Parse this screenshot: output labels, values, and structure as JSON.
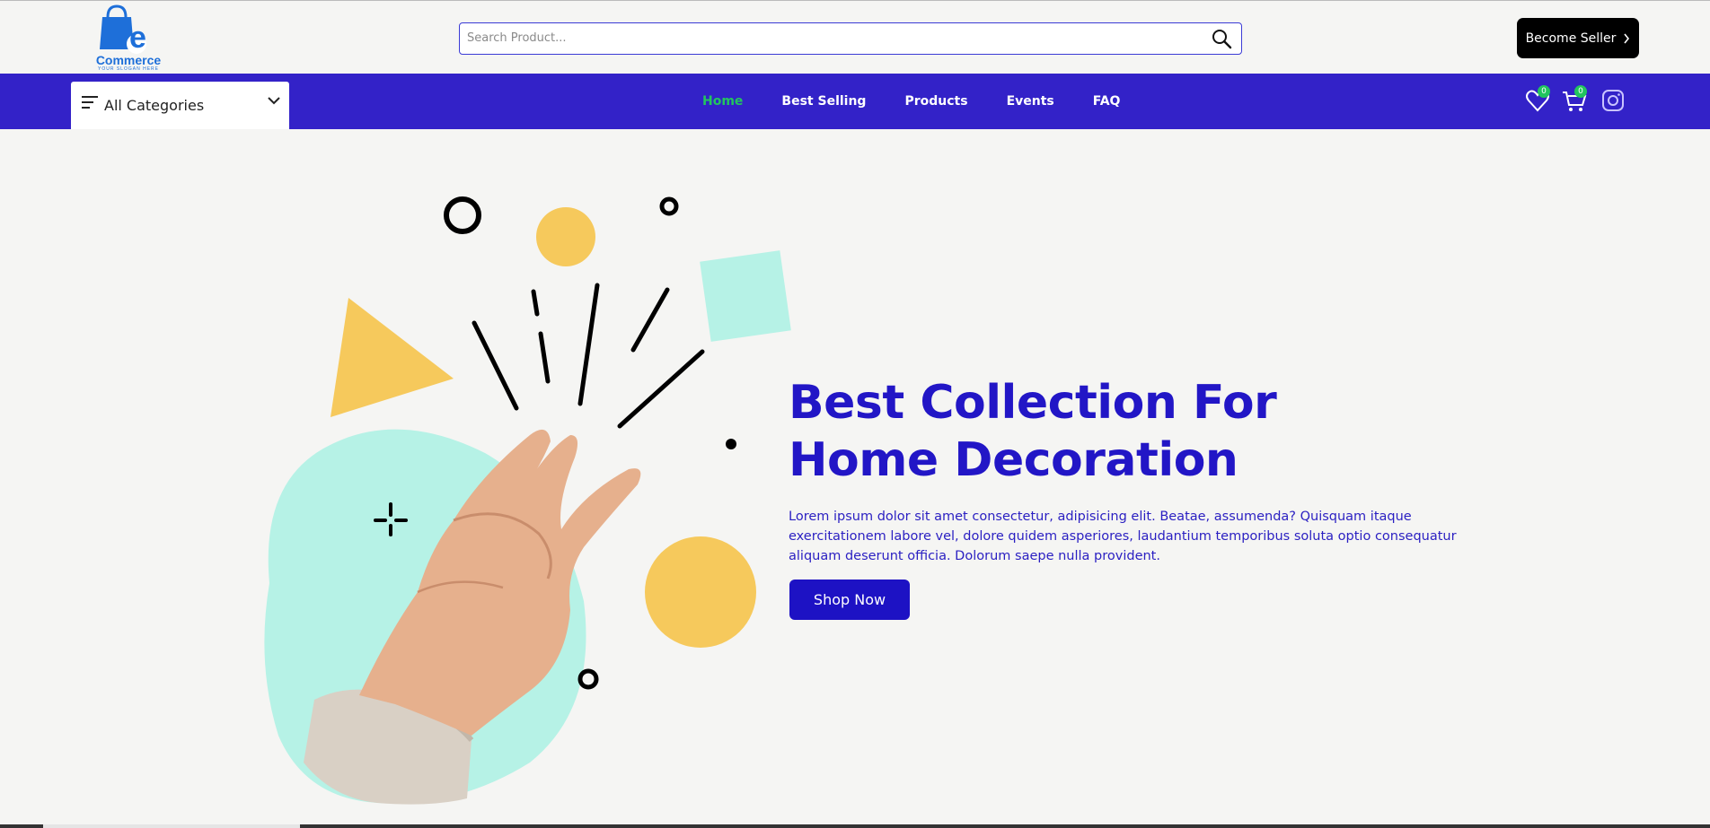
{
  "header": {
    "logo": {
      "word": "Commerce",
      "letter": "e",
      "slogan": "YOUR SLOGAN HERE"
    },
    "search": {
      "placeholder": "Search Product...",
      "value": ""
    },
    "become_seller_label": "Become Seller"
  },
  "nav": {
    "categories_label": "All Categories",
    "links": [
      {
        "label": "Home",
        "active": true
      },
      {
        "label": "Best Selling",
        "active": false
      },
      {
        "label": "Products",
        "active": false
      },
      {
        "label": "Events",
        "active": false
      },
      {
        "label": "FAQ",
        "active": false
      }
    ],
    "wishlist_count": "0",
    "cart_count": "0",
    "icons": [
      "heart-icon",
      "cart-icon",
      "instagram-icon"
    ]
  },
  "hero": {
    "title_line1": "Best Collection For",
    "title_line2": "Home Decoration",
    "description": "Lorem ipsum dolor sit amet consectetur, adipisicing elit. Beatae, assumenda? Quisquam itaque exercitationem labore vel, dolore quidem asperiores, laudantium temporibus soluta optio consequatur aliquam deserunt officia. Dolorum saepe nulla provident.",
    "button_label": "Shop Now"
  },
  "colors": {
    "nav_bg": "#3322c8",
    "accent_blue": "#2216c6",
    "active_green": "#22c55e",
    "mint": "#b6f2e6",
    "yellow": "#f6c95c"
  }
}
